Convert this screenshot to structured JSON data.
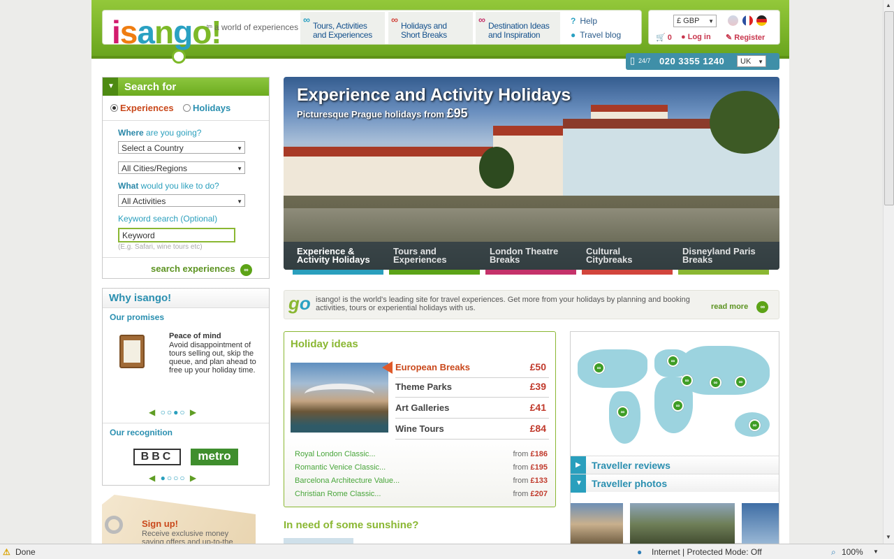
{
  "header": {
    "logo": "isango!",
    "logo_tm": "tm",
    "tagline": "a world of experiences",
    "nav": [
      {
        "line1": "Tours, Activities",
        "line2": "and Experiences"
      },
      {
        "line1": "Holidays and",
        "line2": "Short Breaks"
      },
      {
        "line1": "Destination Ideas",
        "line2": "and Inspiration"
      }
    ],
    "help": "Help",
    "travel_blog": "Travel blog",
    "currency": "£ GBP",
    "cart_count": "0",
    "login": "Log in",
    "register": "Register",
    "phone_prefix": "24/7",
    "phone": "020 3355 1240",
    "region": "UK"
  },
  "search": {
    "title": "Search for",
    "radio_experiences": "Experiences",
    "radio_holidays": "Holidays",
    "where_label_bold": "Where",
    "where_label_rest": " are you going?",
    "country_select": "Select a Country",
    "city_select": "All Cities/Regions",
    "what_label_bold": "What",
    "what_label_rest": " would you like to do?",
    "activity_select": "All Activities",
    "keyword_label": "Keyword search (Optional)",
    "keyword_value": "Keyword",
    "keyword_hint": "(E.g. Safari, wine tours etc)",
    "submit": "search experiences"
  },
  "why": {
    "title": "Why isango!",
    "promises_title": "Our promises",
    "promise_heading": "Peace of mind",
    "promise_text": "Avoid disappointment of tours selling out, skip the queue, and plan ahead to free up your holiday time.",
    "recognition_title": "Our recognition",
    "bbc": "BBC",
    "metro": "metro"
  },
  "signup": {
    "title": "Sign up!",
    "text": "Receive exclusive money saving offers and up-to-the"
  },
  "hero": {
    "title": "Experience and Activity Holidays",
    "subtitle": "Picturesque Prague holidays from",
    "price": "£95",
    "tabs": [
      {
        "line1": "Experience &",
        "line2": "Activity Holidays"
      },
      {
        "line1": "Tours and",
        "line2": "Experiences"
      },
      {
        "line1": "London Theatre",
        "line2": "Breaks"
      },
      {
        "line1": "Cultural",
        "line2": "Citybreaks"
      },
      {
        "line1": "Disneyland Paris",
        "line2": "Breaks"
      }
    ]
  },
  "info": {
    "text": "isango! is the world's leading site for travel experiences. Get more from your holidays by planning and booking activities, tours or experiential holidays with us.",
    "read_more": "read more"
  },
  "holiday_ideas": {
    "title": "Holiday ideas",
    "items": [
      {
        "name": "European Breaks",
        "price": "£50"
      },
      {
        "name": "Theme Parks",
        "price": "£39"
      },
      {
        "name": "Art Galleries",
        "price": "£41"
      },
      {
        "name": "Wine Tours",
        "price": "£84"
      }
    ],
    "packages": [
      {
        "name": "Royal London Classic...",
        "from": "from",
        "price": "£186"
      },
      {
        "name": "Romantic Venice Classic...",
        "from": "from",
        "price": "£195"
      },
      {
        "name": "Barcelona Architecture Value...",
        "from": "from",
        "price": "£133"
      },
      {
        "name": "Christian Rome Classic...",
        "from": "from",
        "price": "£207"
      }
    ]
  },
  "sunshine_title": "In need of some sunshine?",
  "side": {
    "traveller_reviews": "Traveller reviews",
    "traveller_photos": "Traveller photos"
  },
  "status": {
    "left": "Done",
    "zone": "Internet | Protected Mode: Off",
    "zoom": "100%"
  },
  "colors": {
    "brand_green": "#7db928",
    "brand_teal": "#2a9fbd",
    "price_red": "#c0392b"
  }
}
